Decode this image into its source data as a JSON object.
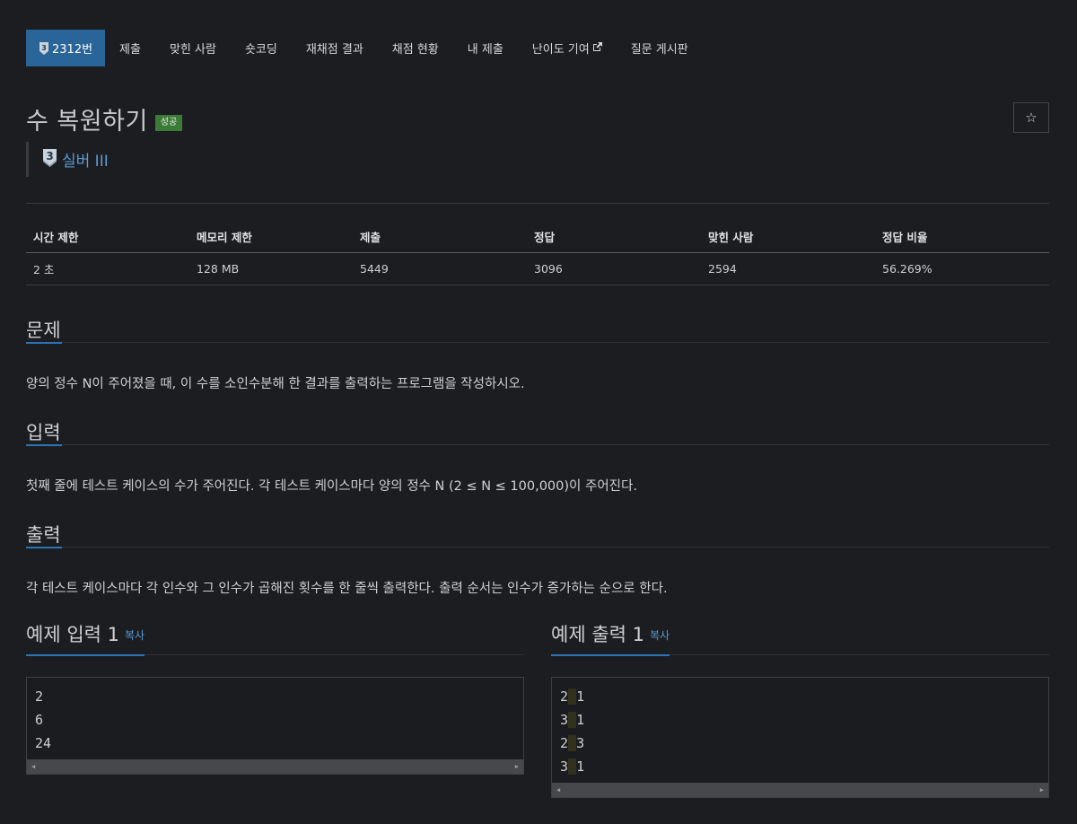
{
  "nav": {
    "problem_number": "2312번",
    "items": [
      "제출",
      "맞힌 사람",
      "숏코딩",
      "재채점 결과",
      "채점 현황",
      "내 제출",
      "난이도 기여",
      "질문 게시판"
    ]
  },
  "problem": {
    "title": "수 복원하기",
    "status_badge": "성공",
    "tier_digit": "3",
    "tier_name": "실버 III"
  },
  "stats": {
    "headers": [
      "시간 제한",
      "메모리 제한",
      "제출",
      "정답",
      "맞힌 사람",
      "정답 비율"
    ],
    "values": [
      "2 초",
      "128 MB",
      "5449",
      "3096",
      "2594",
      "56.269%"
    ]
  },
  "sections": {
    "problem_heading": "문제",
    "problem_text": "양의 정수 N이 주어졌을 때, 이 수를 소인수분해 한 결과를 출력하는 프로그램을 작성하시오.",
    "input_heading": "입력",
    "input_text": "첫째 줄에 테스트 케이스의 수가 주어진다. 각 테스트 케이스마다 양의 정수 N (2 ≤ N ≤ 100,000)이 주어진다.",
    "output_heading": "출력",
    "output_text": "각 테스트 케이스마다 각 인수와 그 인수가 곱해진 횟수를 한 줄씩 출력한다. 출력 순서는 인수가 증가하는 순으로 한다."
  },
  "samples": {
    "input_title": "예제 입력 1",
    "output_title": "예제 출력 1",
    "copy_label": "복사",
    "input_lines": [
      "2",
      "6",
      "24"
    ],
    "output_lines": [
      [
        "2",
        "1"
      ],
      [
        "3",
        "1"
      ],
      [
        "2",
        "3"
      ],
      [
        "3",
        "1"
      ]
    ]
  },
  "icons": {
    "star": "star-icon",
    "external_link": "external-link-icon",
    "tier": "silver-tier-icon"
  },
  "colors": {
    "accent": "#2a6599",
    "success": "#3c7a37",
    "tier_link": "#5a9bd5"
  }
}
